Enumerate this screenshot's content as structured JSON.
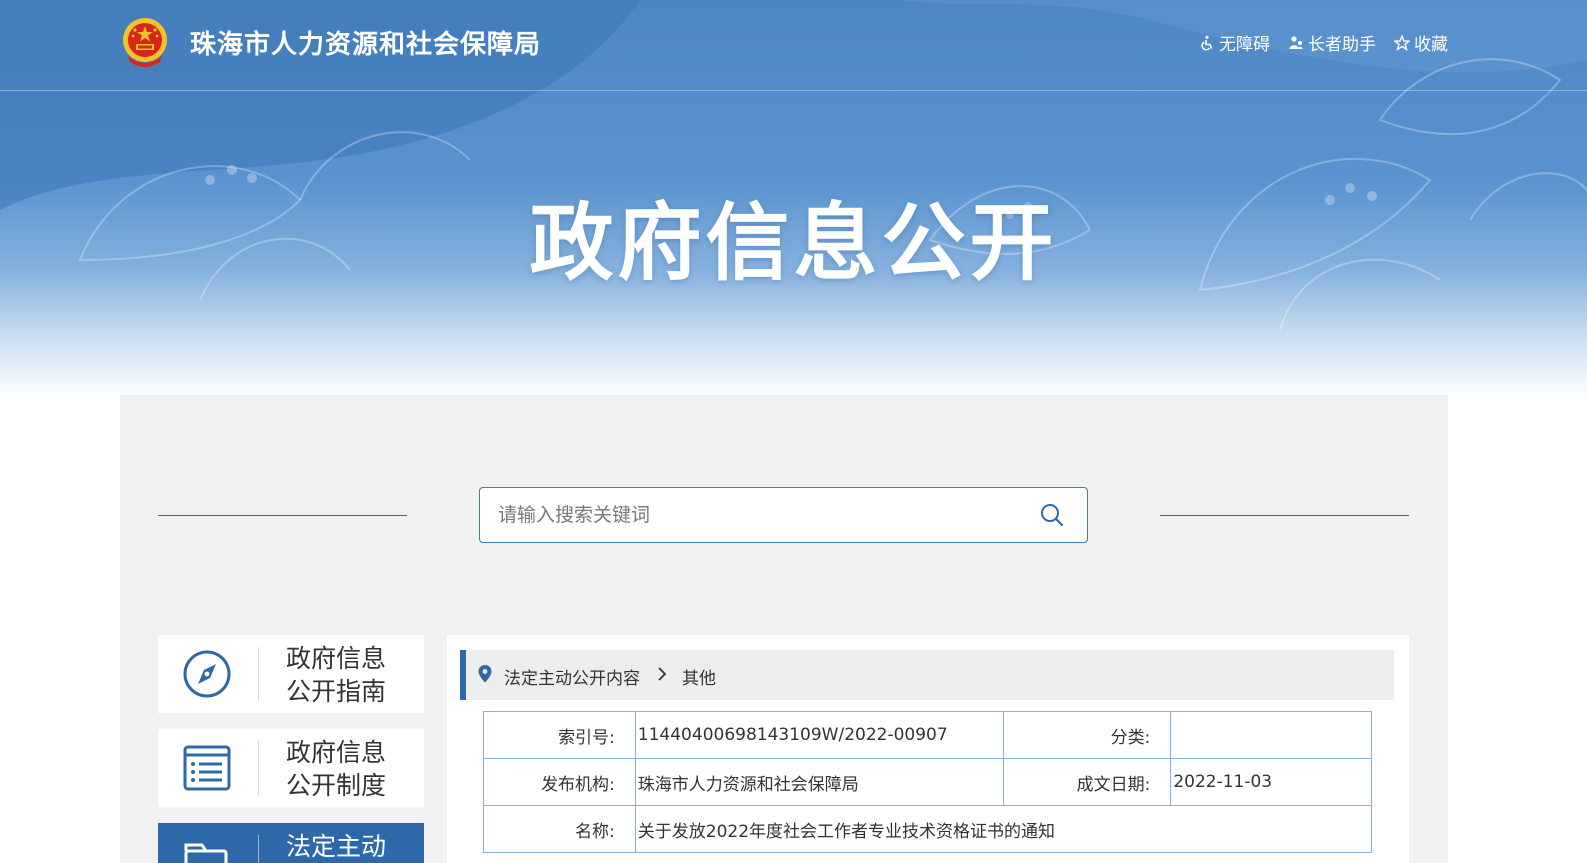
{
  "header": {
    "site_title": "珠海市人力资源和社会保障局",
    "links": [
      {
        "label": "无障碍",
        "icon": "wheelchair-icon"
      },
      {
        "label": "长者助手",
        "icon": "elder-helper-icon"
      },
      {
        "label": "收藏",
        "icon": "star-icon"
      }
    ]
  },
  "hero": {
    "title": "政府信息公开"
  },
  "search": {
    "placeholder": "请输入搜索关键词"
  },
  "sidebar": {
    "items": [
      {
        "label": "政府信息公开指南",
        "icon": "compass-icon",
        "active": false
      },
      {
        "label": "政府信息公开制度",
        "icon": "document-list-icon",
        "active": false
      },
      {
        "label": "法定主动",
        "icon": "folder-icon",
        "active": true
      }
    ]
  },
  "breadcrumb": {
    "parent": "法定主动公开内容",
    "current": "其他"
  },
  "meta": {
    "index_label": "索引号:",
    "index_value": "11440400698143109W/2022-00907",
    "category_label": "分类:",
    "category_value": "",
    "publisher_label": "发布机构:",
    "publisher_value": "珠海市人力资源和社会保障局",
    "date_label": "成文日期:",
    "date_value": "2022-11-03",
    "name_label": "名称:",
    "name_value": "关于发放2022年度社会工作者专业技术资格证书的通知"
  },
  "colors": {
    "banner_blue": "#4d86c4",
    "accent_blue": "#2d68a8",
    "border_blue": "#86b2dd",
    "panel_gray": "#f1f1f1",
    "emblem_red": "#d8261c",
    "emblem_gold": "#f5c22a"
  }
}
